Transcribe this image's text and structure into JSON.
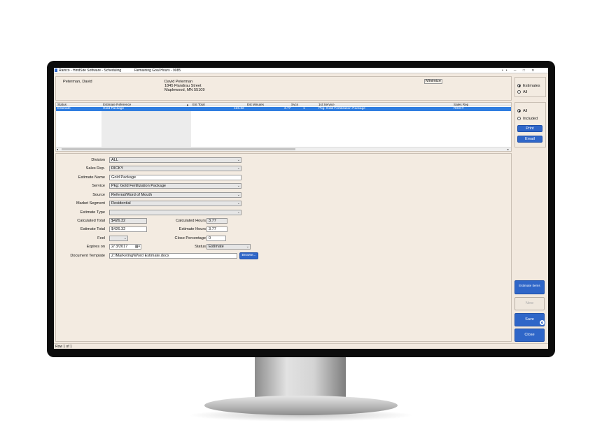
{
  "titlebar": {
    "app_title": "Rainco - HindSite Software - Scheduling",
    "goal_hours": "Remaining Goal Hours - 9085",
    "controls": "•• ─ □ ✕"
  },
  "customer": {
    "name": "Peterman, David",
    "address_name": "David Peterman",
    "street": "1845 Flandrau Street",
    "city": "Maplewood, MN  55109",
    "minimize_label": "Minimize"
  },
  "table": {
    "headers": [
      "Status",
      "Estimate Reference",
      "Est Total",
      "Est Minutes",
      "Svcs",
      "1st Service",
      "Sales Rep"
    ],
    "row": [
      "Estimate",
      "Gold Package",
      "426.32",
      "3.77",
      "1",
      "Pkg: Gold Fertilization Package",
      "RICKY"
    ],
    "sort_indicator": "▲",
    "row_count": "Row 1 of 1"
  },
  "form": {
    "division_label": "Division",
    "division_value": "ALL",
    "sales_rep_label": "Sales Rep.",
    "sales_rep_value": "RICKY",
    "estimate_name_label": "Estimate Name",
    "estimate_name_value": "Gold Package",
    "service_label": "Service",
    "service_value": "Pkg: Gold Fertilization Package",
    "source_label": "Source",
    "source_value": "Referral/Word of Mouth",
    "market_segment_label": "Market Segment",
    "market_segment_value": "Residential",
    "estimate_type_label": "Estimate Type",
    "estimate_type_value": "",
    "calculated_total_label": "Calculated Total",
    "calculated_total_value": "$426.32",
    "estimate_total_label": "Estimate Total",
    "estimate_total_value": "$426.32",
    "feel_label": "Feel",
    "feel_value": "",
    "expires_label": "Expires on",
    "expires_value": "2/  3/2017",
    "calculated_hours_label": "Calculated Hours",
    "calculated_hours_value": "3.77",
    "estimate_hours_label": "Estimate Hours",
    "estimate_hours_value": "3.77",
    "close_percentage_label": "Close Percentage",
    "close_percentage_value": "0",
    "status_label": "Status",
    "status_value": "Estimate",
    "template_label": "Document Template",
    "template_value": "Z:\\Marketing\\Word Estimate.docx",
    "browse_label": "Browse..."
  },
  "side": {
    "radio_estimates": "Estimates",
    "radio_all": "All",
    "radio_all2": "All",
    "radio_included": "Included",
    "print_label": "Print",
    "email_label": "Email",
    "estimate_items_label": "Estimate Items",
    "new_label": "New",
    "save_label": "Save",
    "close_label": "Close"
  },
  "colors": {
    "accent": "#2f66c8",
    "selection": "#2f7de0",
    "background": "#f2e9df"
  }
}
